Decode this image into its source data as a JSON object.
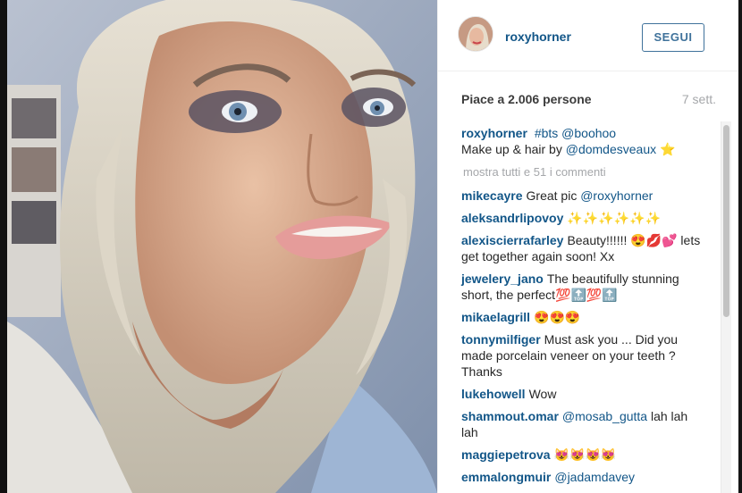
{
  "post": {
    "username": "roxyhorner",
    "follow_label": "SEGUI",
    "likes": "Piace a 2.006 persone",
    "age": "7 sett."
  },
  "caption": {
    "author": "roxyhorner",
    "text_1": "#bts @boohoo",
    "line_2_prefix": "Make up & hair by ",
    "mention": "@domdesveaux",
    "emoji": "⭐"
  },
  "load_more": "mostra tutti e 51 i commenti",
  "comments": [
    {
      "author": "mikecayre",
      "text": "Great pic ",
      "mention": "@roxyhorner"
    },
    {
      "author": "aleksandrlipovoy",
      "text": "✨✨✨✨✨✨"
    },
    {
      "author": "alexiscierrafarley",
      "text": "Beauty!!!!!! 😍💋💕 lets get together again soon! Xx"
    },
    {
      "author": "jewelery_jano",
      "text": "The beautifully stunning short, the perfect💯🔝💯🔝"
    },
    {
      "author": "mikaelagrill",
      "text": "😍😍😍"
    },
    {
      "author": "tonnymilfiger",
      "text": "Must ask you ... Did you made porcelain veneer on your teeth ? Thanks"
    },
    {
      "author": "lukehowell",
      "text": "Wow"
    },
    {
      "author": "shammout.omar",
      "text": " lah lah lah",
      "mention": "@mosab_gutta"
    },
    {
      "author": "maggiepetrova",
      "text": "😻😻😻😻"
    },
    {
      "author": "emmalongmuir",
      "text": "",
      "mention": "@jadamdavey"
    }
  ],
  "colors": {
    "link": "#125688",
    "follow": "#3f729b",
    "muted": "#a5a7aa"
  },
  "icons": {
    "avatar": "profile-avatar"
  }
}
